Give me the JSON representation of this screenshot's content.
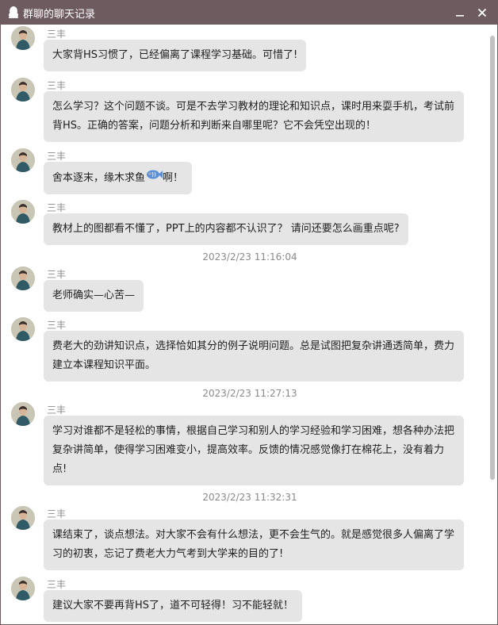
{
  "window": {
    "title": "群聊的聊天记录",
    "icons": {
      "app": "penguin-icon",
      "minimize": "minimize-icon",
      "close": "close-icon"
    },
    "colors": {
      "titlebar": "#6e5b60",
      "bubble": "#e5e5e5",
      "timestamp": "#8a8a8a"
    }
  },
  "messages": [
    {
      "sender": "三丰",
      "text": "大家背HS习惯了，已经偏离了课程学习基础。可惜了!"
    },
    {
      "sender": "三丰",
      "text": "怎么学习？这个问题不谈。可是不去学习教材的理论和知识点，课时用来耍手机，考试前背HS。正确的答案，问题分析和判断来自哪里呢？它不会凭空出现的！"
    },
    {
      "sender": "三丰",
      "text_before": "舍本逐末，缘木求鱼",
      "emoji": "fish-emoji",
      "text_after": "啊！"
    },
    {
      "sender": "三丰",
      "text": "教材上的图都看不懂了，PPT上的内容都不认识了？  请问还要怎么画重点呢?"
    },
    {
      "timestamp": "2023/2/23 11:16:04"
    },
    {
      "sender": "三丰",
      "text": "老师确实—心苦—"
    },
    {
      "sender": "三丰",
      "text": "费老大的劲讲知识点，选择恰如其分的例子说明问题。总是试图把复杂讲通透简单，费力建立本课程知识平面。"
    },
    {
      "timestamp": "2023/2/23 11:27:13"
    },
    {
      "sender": "三丰",
      "text": "学习对谁都不是轻松的事情，根据自己学习和别人的学习经验和学习困难，想各种办法把复杂讲简单，使得学习困难变小，提高效率。反馈的情况感觉像打在棉花上，没有着力点!"
    },
    {
      "timestamp": "2023/2/23 11:32:31"
    },
    {
      "sender": "三丰",
      "text": "课结束了，谈点想法。对大家不会有什么想法，更不会生气的。就是感觉很多人偏离了学习的初衷，忘记了费老大力气考到大学来的目的了!"
    },
    {
      "sender": "三丰",
      "text": "建议大家不要再背HS了，道不可轻得！习不能轻就！"
    }
  ]
}
